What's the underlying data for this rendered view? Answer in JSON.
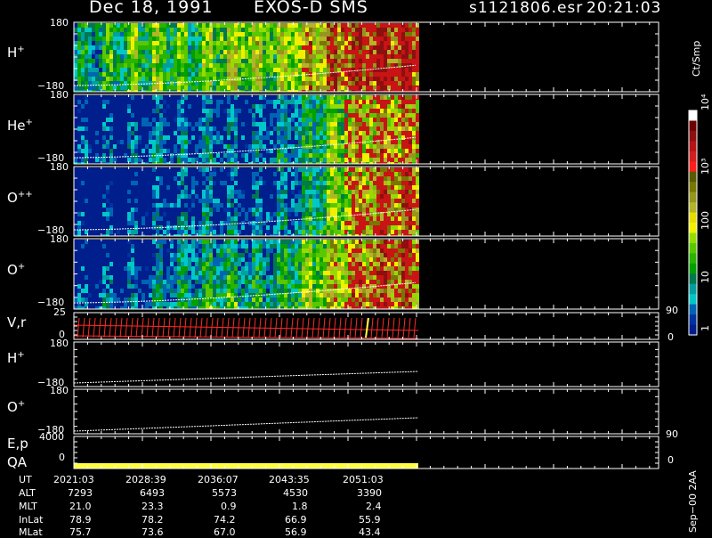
{
  "header": {
    "date": "Dec 18, 1991",
    "instrument": "EXOS-D SMS",
    "file": "s1121806.esr",
    "time": "20:21:03"
  },
  "panels": [
    {
      "label": "H",
      "sup": "+",
      "ytop": "180",
      "ybot": "−180"
    },
    {
      "label": "He",
      "sup": "+",
      "ytop": "180",
      "ybot": "−180"
    },
    {
      "label": "O",
      "sup": "++",
      "ytop": "180",
      "ybot": "−180"
    },
    {
      "label": "O",
      "sup": "+",
      "ytop": "180",
      "ybot": "−180"
    }
  ],
  "vr_panel": {
    "label": "V,r",
    "ytop": "25",
    "ybot": "0",
    "right_top": "90",
    "right_bot": "0"
  },
  "line_panels": [
    {
      "label": "H",
      "sup": "+",
      "ytop": "180",
      "ybot": "−180"
    },
    {
      "label": "O",
      "sup": "+",
      "ytop": "180",
      "ybot": "−180"
    }
  ],
  "ep_panel": {
    "label": "E,p",
    "ytop": "4000",
    "ybot": "0",
    "right_top": "90",
    "right_bot": "0"
  },
  "qa_label": "QA",
  "colorbar": {
    "unit": "Ct/Smp",
    "ticks": [
      "10⁴",
      "10³",
      "100",
      "10",
      "1"
    ],
    "colors": [
      "#ffffff",
      "#6e0000",
      "#8c1010",
      "#b41414",
      "#d21e1e",
      "#ff1e1e",
      "#5a5a00",
      "#787800",
      "#96961e",
      "#b4b428",
      "#e6dc00",
      "#f0f000",
      "#96dc00",
      "#5ac800",
      "#28b400",
      "#00a000",
      "#007850",
      "#00a0a0",
      "#00c8c8",
      "#0064b4",
      "#0032a0",
      "#001e8c"
    ],
    "footer": "Sep−00 2AA"
  },
  "time_table": {
    "rows": [
      {
        "name": "UT",
        "values": [
          "2021:03",
          "2028:39",
          "2036:07",
          "2043:35",
          "2051:03"
        ]
      },
      {
        "name": "ALT",
        "values": [
          "7293",
          "6493",
          "5573",
          "4530",
          "3390"
        ]
      },
      {
        "name": "MLT",
        "values": [
          "21.0",
          "23.3",
          "0.9",
          "1.8",
          "2.4"
        ]
      },
      {
        "name": "InLat",
        "values": [
          "78.9",
          "78.2",
          "74.2",
          "66.9",
          "55.9"
        ]
      },
      {
        "name": "MLat",
        "values": [
          "75.7",
          "73.6",
          "67.0",
          "56.9",
          "43.4"
        ]
      }
    ]
  },
  "chart_data": {
    "type": "heatmap",
    "title": "Dec 18, 1991   EXOS-D SMS",
    "x": [
      "2021:03",
      "2028:39",
      "2036:07",
      "2043:35",
      "2051:03"
    ],
    "series": [
      {
        "name": "H+",
        "values": [
          0.25,
          0.35,
          0.45,
          0.5,
          0.4,
          0.55,
          0.6,
          0.55,
          0.7,
          0.85,
          0.95,
          0.95,
          0.9
        ]
      },
      {
        "name": "He+",
        "values": [
          0.1,
          0.15,
          0.15,
          0.2,
          0.2,
          0.2,
          0.15,
          0.2,
          0.35,
          0.55,
          0.7,
          0.75,
          0.7
        ]
      },
      {
        "name": "O++",
        "values": [
          0.05,
          0.05,
          0.05,
          0.15,
          0.2,
          0.2,
          0.15,
          0.15,
          0.3,
          0.55,
          0.75,
          0.85,
          0.8
        ]
      },
      {
        "name": "O+",
        "values": [
          0.1,
          0.15,
          0.15,
          0.25,
          0.35,
          0.45,
          0.35,
          0.35,
          0.55,
          0.7,
          0.8,
          0.85,
          0.8
        ]
      }
    ],
    "ylim": [
      -180,
      180
    ],
    "colorbar_range": [
      1,
      10000
    ]
  }
}
